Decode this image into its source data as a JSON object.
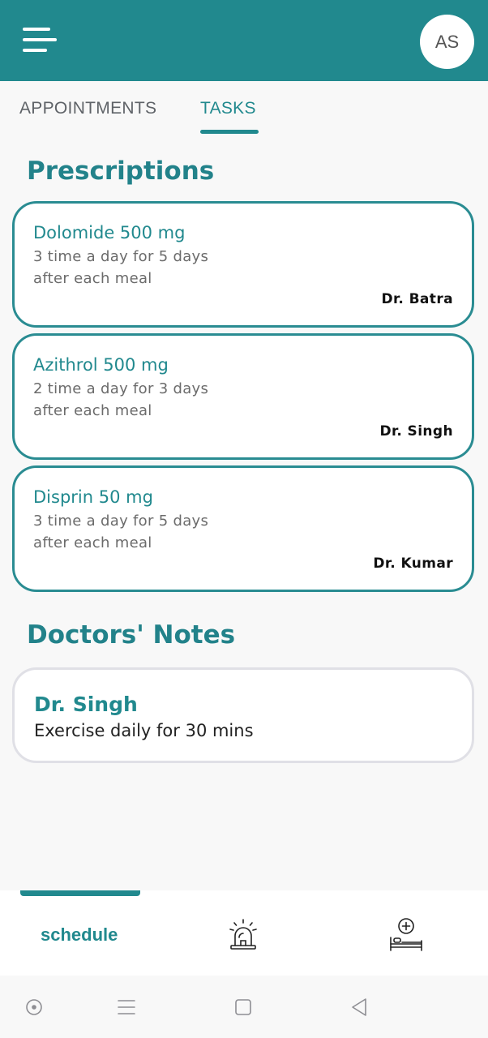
{
  "header": {
    "menu_icon": "hamburger-menu-icon",
    "avatar_initials": "AS"
  },
  "tabs": [
    {
      "label": "APPOINTMENTS",
      "active": false
    },
    {
      "label": "TASKS",
      "active": true
    }
  ],
  "prescriptions": {
    "title": "Prescriptions",
    "items": [
      {
        "drug": "Dolomide 500 mg",
        "dose": "3 time a day for 5 days",
        "meal": "after each meal",
        "doctor": "Dr. Batra"
      },
      {
        "drug": "Azithrol 500 mg",
        "dose": "2 time a day for 3 days",
        "meal": "after each meal",
        "doctor": "Dr. Singh"
      },
      {
        "drug": "Disprin 50 mg",
        "dose": "3 time a day for 5 days",
        "meal": "after each meal",
        "doctor": "Dr. Kumar"
      }
    ]
  },
  "notes": {
    "title": "Doctors' Notes",
    "items": [
      {
        "doctor": "Dr. Singh",
        "text": "Exercise daily for 30 mins"
      }
    ]
  },
  "bottom_nav": {
    "schedule_label": "schedule",
    "alarm_icon": "siren-alarm-icon",
    "hospital_icon": "hospital-bed-icon"
  },
  "system_nav": {
    "icons": [
      "circle-dot-icon",
      "menu-lines-icon",
      "square-home-icon",
      "back-triangle-icon"
    ]
  },
  "colors": {
    "primary": "#21898e",
    "background": "#f8f8f8"
  }
}
